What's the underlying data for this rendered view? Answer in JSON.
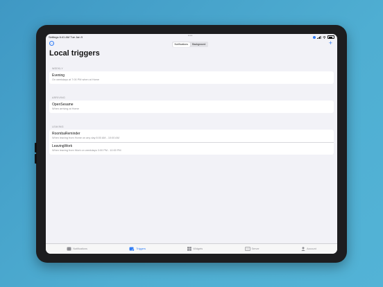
{
  "status_bar": {
    "left": "Settings  6:41 AM   Tue Jan 9",
    "dots": "•••"
  },
  "nav": {
    "more_label": "…",
    "segments": [
      "Notifications",
      "Background"
    ],
    "selected_segment": "Notifications",
    "add_label": "+"
  },
  "page_title": "Local triggers",
  "sections": [
    {
      "header": "WEEKLY",
      "rows": [
        {
          "title": "Evening",
          "subtitle": "On weekdays at 7:00 PM when at Home"
        }
      ]
    },
    {
      "header": "ARRIVING",
      "rows": [
        {
          "title": "OpenSesame",
          "subtitle": "When arriving at Home"
        }
      ]
    },
    {
      "header": "LEAVING",
      "rows": [
        {
          "title": "RoombaReminder",
          "subtitle": "When leaving from Home on any day 8:00 AM - 10:00 AM"
        },
        {
          "title": "LeavingWork",
          "subtitle": "When leaving from Work on weekdays 3:00 PM - 10:00 PM"
        }
      ]
    }
  ],
  "tab_bar": {
    "tabs": [
      {
        "label": "Notifications",
        "icon": "notifications-icon"
      },
      {
        "label": "Triggers",
        "icon": "triggers-icon"
      },
      {
        "label": "Widgets",
        "icon": "widgets-icon"
      },
      {
        "label": "Server",
        "icon": "server-icon"
      },
      {
        "label": "Account",
        "icon": "account-icon"
      }
    ],
    "active": "Triggers"
  },
  "colors": {
    "accent": "#2f7cf6",
    "background": "#f2f2f7",
    "wallpaper": "#4aa6cc"
  }
}
